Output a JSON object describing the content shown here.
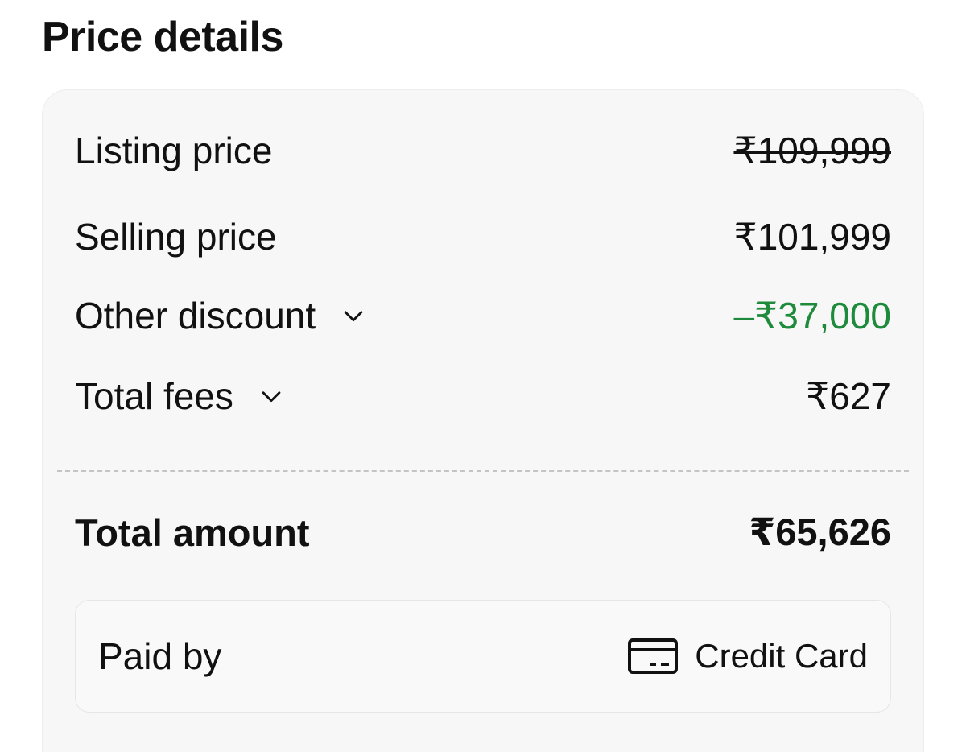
{
  "header": {
    "title": "Price details"
  },
  "price_rows": [
    {
      "label": "Listing price",
      "value": "₹109,999",
      "struck_through": true,
      "expandable": false
    },
    {
      "label": "Selling price",
      "value": "₹101,999",
      "struck_through": false,
      "expandable": false
    },
    {
      "label": "Other discount",
      "value": "–₹37,000",
      "struck_through": false,
      "expandable": true,
      "value_color": "#1e8a3b"
    },
    {
      "label": "Total fees",
      "value": "₹627",
      "struck_through": false,
      "expandable": true
    }
  ],
  "total": {
    "label": "Total amount",
    "value": "₹65,626"
  },
  "payment": {
    "label": "Paid by",
    "method": "Credit Card",
    "icon": "credit-card-icon"
  },
  "colors": {
    "discount": "#1e8a3b",
    "card_background": "#f7f7f8",
    "text": "#111111"
  }
}
